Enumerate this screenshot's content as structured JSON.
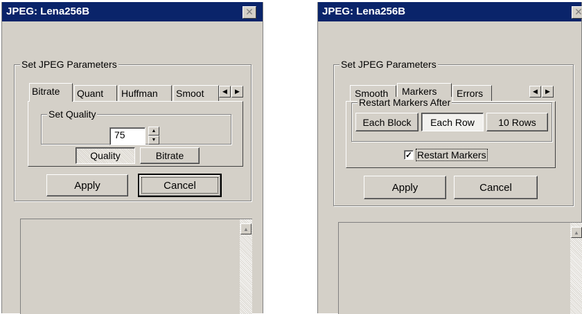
{
  "window1": {
    "title": "JPEG: Lena256B",
    "group_title": "Set JPEG Parameters",
    "tabs": [
      {
        "label": "Bitrate",
        "active": true
      },
      {
        "label": "Quant",
        "active": false
      },
      {
        "label": "Huffman",
        "active": false
      },
      {
        "label": "Smoot",
        "active": false
      }
    ],
    "quality_group_title": "Set Quality",
    "quality_value": "75",
    "mode_buttons": [
      {
        "label": "Quality",
        "pressed": true
      },
      {
        "label": "Bitrate",
        "pressed": false
      }
    ],
    "apply_label": "Apply",
    "cancel_label": "Cancel"
  },
  "window2": {
    "title": "JPEG: Lena256B",
    "group_title": "Set JPEG Parameters",
    "tabs": [
      {
        "label": "Smooth",
        "active": false
      },
      {
        "label": "Markers",
        "active": true
      },
      {
        "label": "Errors",
        "active": false
      }
    ],
    "restart_group_title": "Restart Markers After",
    "restart_buttons": [
      {
        "label": "Each Block",
        "pressed": false
      },
      {
        "label": "Each Row",
        "pressed": true
      },
      {
        "label": "10 Rows",
        "pressed": false
      }
    ],
    "checkbox_label": "Restart Markers",
    "checkbox_checked": true,
    "apply_label": "Apply",
    "cancel_label": "Cancel"
  },
  "icons": {
    "close": "close-icon",
    "left_arrow": "left-arrow-icon",
    "right_arrow": "right-arrow-icon",
    "spin_up": "spin-up-icon",
    "spin_down": "spin-down-icon",
    "scroll_up": "scroll-up-icon",
    "check": "checkmark-icon"
  },
  "colors": {
    "title_bar": "#0a246a",
    "face": "#d4d0c8"
  }
}
